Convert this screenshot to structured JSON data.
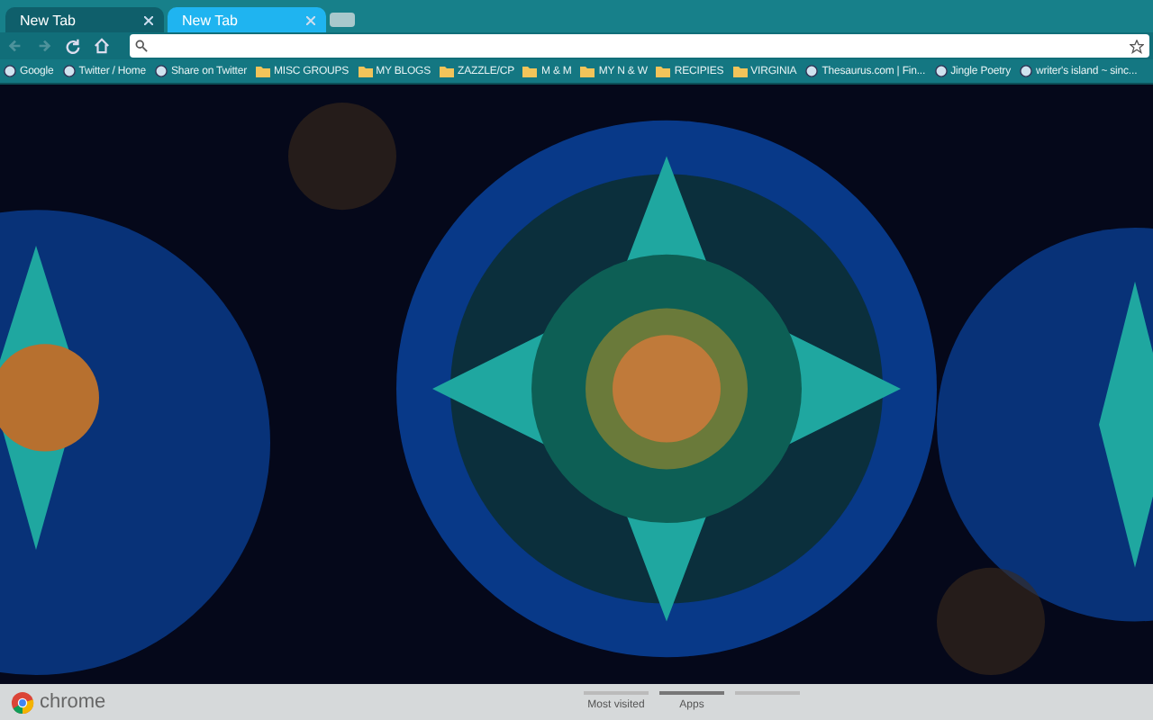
{
  "tabs": [
    {
      "title": "New Tab",
      "selected": false
    },
    {
      "title": "New Tab",
      "selected": true
    }
  ],
  "toolbar": {
    "back_disabled": true,
    "forward_disabled": true
  },
  "bookmarks": [
    {
      "label": "Google",
      "kind": "site"
    },
    {
      "label": "Twitter / Home",
      "kind": "site"
    },
    {
      "label": "Share on Twitter",
      "kind": "site"
    },
    {
      "label": "MISC GROUPS",
      "kind": "folder"
    },
    {
      "label": "MY BLOGS",
      "kind": "folder"
    },
    {
      "label": "ZAZZLE/CP",
      "kind": "folder"
    },
    {
      "label": "M & M",
      "kind": "folder"
    },
    {
      "label": "MY N & W",
      "kind": "folder"
    },
    {
      "label": "RECIPIES",
      "kind": "folder"
    },
    {
      "label": "VIRGINIA",
      "kind": "folder"
    },
    {
      "label": "Thesaurus.com | Fin...",
      "kind": "site"
    },
    {
      "label": "Jingle Poetry",
      "kind": "site"
    },
    {
      "label": "writer's island ~ sinc...",
      "kind": "site"
    }
  ],
  "footer": {
    "logo": "chrome",
    "pages": [
      {
        "label": "Most visited",
        "selected": false
      },
      {
        "label": "Apps",
        "selected": true
      },
      {
        "selected": false
      }
    ]
  }
}
